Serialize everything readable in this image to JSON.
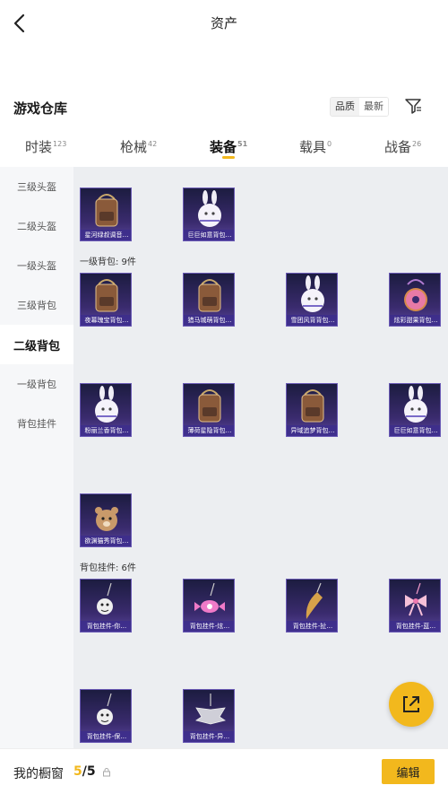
{
  "nav": {
    "title": "资产"
  },
  "section": {
    "title": "游戏仓库",
    "sort_quality": "品质",
    "sort_latest": "最新"
  },
  "tabs": [
    {
      "label": "时装",
      "count": "123"
    },
    {
      "label": "枪械",
      "count": "42"
    },
    {
      "label": "装备",
      "count": "51"
    },
    {
      "label": "载具",
      "count": "0"
    },
    {
      "label": "战备",
      "count": "26"
    }
  ],
  "sidebar": {
    "items": [
      "三级头盔",
      "二级头盔",
      "一级头盔",
      "三级背包",
      "二级背包",
      "一级背包",
      "背包挂件"
    ],
    "active_index": 4
  },
  "groups": {
    "top_items": [
      {
        "caption": "星河绿叔调音…",
        "icon": "backpack-icon"
      },
      {
        "caption": "巨巨如意背包…",
        "icon": "bunny-backpack-icon"
      }
    ],
    "level1": {
      "label": "一级背包: 9件",
      "items": [
        {
          "caption": "夜幕瑰宝背包…",
          "icon": "backpack-icon"
        },
        {
          "caption": "猎马城萌背包…",
          "icon": "backpack-icon"
        },
        {
          "caption": "雪团风背背包…",
          "icon": "bunny-backpack-icon"
        },
        {
          "caption": "炫彩甜果背包…",
          "icon": "donut-backpack-icon"
        },
        {
          "caption": "粉丽兰香背包…",
          "icon": "bunny-backpack-icon"
        },
        {
          "caption": "薄荷星隐背包…",
          "icon": "backpack-icon"
        },
        {
          "caption": "异域追梦背包…",
          "icon": "backpack-icon"
        },
        {
          "caption": "巨巨如意背包…",
          "icon": "bunny-backpack-icon"
        },
        {
          "caption": "欲渊猫秀背包…",
          "icon": "bear-backpack-icon"
        }
      ]
    },
    "charms": {
      "label": "背包挂件: 6件",
      "items": [
        {
          "caption": "背包挂件-你…",
          "icon": "charm-icon"
        },
        {
          "caption": "背包挂件-炫…",
          "icon": "candy-charm-icon"
        },
        {
          "caption": "背包挂件-扯…",
          "icon": "blade-charm-icon"
        },
        {
          "caption": "背包挂件-蓝…",
          "icon": "bow-charm-icon"
        },
        {
          "caption": "背包挂件-保…",
          "icon": "charm-icon"
        },
        {
          "caption": "背包挂件-异…",
          "icon": "wing-charm-icon"
        }
      ]
    }
  },
  "showcase": {
    "label": "我的橱窗",
    "current": "5",
    "total": "/5",
    "edit_label": "编辑"
  },
  "colors": {
    "accent": "#f2b81d",
    "card_bg": "#2a2458",
    "content_bg": "#eceef1"
  }
}
